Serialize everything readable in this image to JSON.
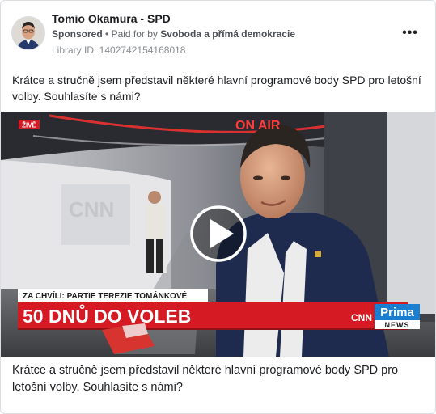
{
  "post": {
    "page_name": "Tomio Okamura - SPD",
    "sponsored": "Sponsored",
    "paid_for_prefix": "Paid for by",
    "payer": "Svoboda a přímá demokracie",
    "library_id": "Library ID: 1402742154168018",
    "text": "Krátce a stručně jsem představil některé hlavní programové body SPD pro letošní volby. Souhlasíte s námi?",
    "more_icon": "ellipsis-icon"
  },
  "video": {
    "live_badge": "ŽIVĚ",
    "studio_sign": "ON AIR",
    "wall_logo": "CNN",
    "ticker_top": "ZA CHVÍLI: PARTIE TEREZIE TOMÁNKOVÉ",
    "ticker_main": "50 DNŮ DO VOLEB",
    "logo_cnn": "CNN",
    "logo_prima": "Prima",
    "logo_news": "NEWS",
    "play_icon": "play-icon"
  },
  "caption": {
    "text": "Krátce a stručně jsem představil některé hlavní programové body SPD pro letošní volby. Souhlasíte s námi?"
  },
  "colors": {
    "ticker_red": "#d51a24",
    "text_primary": "#1c1e21",
    "text_secondary": "#65676b"
  }
}
